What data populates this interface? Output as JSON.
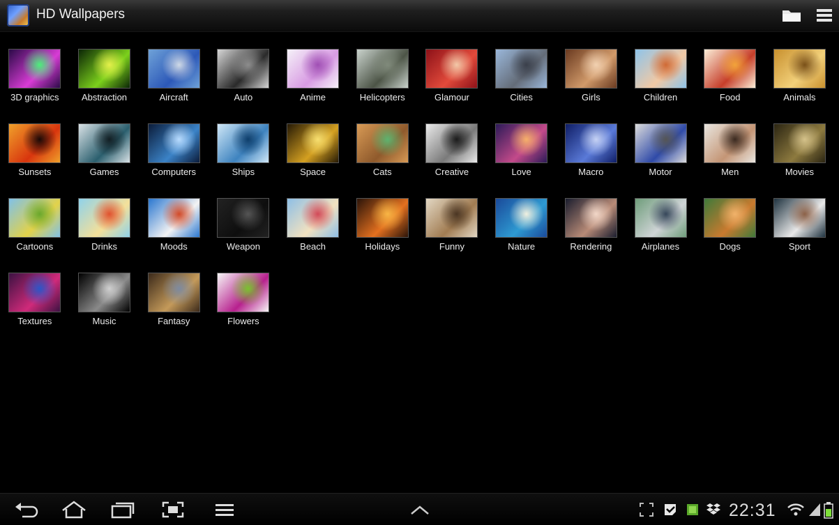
{
  "app": {
    "title": "HD Wallpapers"
  },
  "categories": [
    {
      "label": "3D graphics",
      "colors": [
        "#2b0a48",
        "#d83cd5",
        "#4bf07a"
      ]
    },
    {
      "label": "Abstraction",
      "colors": [
        "#0b2506",
        "#7cd11c",
        "#e4f04b"
      ]
    },
    {
      "label": "Aircraft",
      "colors": [
        "#6fa2d8",
        "#2c58b8",
        "#cfd9e6"
      ]
    },
    {
      "label": "Auto",
      "colors": [
        "#d6d6d6",
        "#2a2a2a",
        "#8d8d8d"
      ]
    },
    {
      "label": "Anime",
      "colors": [
        "#f5f1f8",
        "#d89be3",
        "#a04fb4"
      ]
    },
    {
      "label": "Helicopters",
      "colors": [
        "#c9d2cc",
        "#4c5446",
        "#808a7b"
      ]
    },
    {
      "label": "Glamour",
      "colors": [
        "#8d1118",
        "#e24a3b",
        "#f2c8a8"
      ]
    },
    {
      "label": "Cities",
      "colors": [
        "#9ab7da",
        "#646c78",
        "#3a3f4a"
      ]
    },
    {
      "label": "Girls",
      "colors": [
        "#6a3a20",
        "#d19a6a",
        "#f2d1b1"
      ]
    },
    {
      "label": "Children",
      "colors": [
        "#8ec4ea",
        "#f1c9a5",
        "#d06a35"
      ]
    },
    {
      "label": "Food",
      "colors": [
        "#fbeed8",
        "#c63e2a",
        "#f2a33a"
      ]
    },
    {
      "label": "Animals",
      "colors": [
        "#c8902e",
        "#f2d07a",
        "#7a5018"
      ]
    },
    {
      "label": "Sunsets",
      "colors": [
        "#f0a02a",
        "#d8350e",
        "#1a0906"
      ]
    },
    {
      "label": "Games",
      "colors": [
        "#d9e2e6",
        "#2b5f6e",
        "#121e23"
      ]
    },
    {
      "label": "Computers",
      "colors": [
        "#0b1c3a",
        "#3b83c7",
        "#b9dcff"
      ]
    },
    {
      "label": "Ships",
      "colors": [
        "#cfe7f7",
        "#3e83bf",
        "#0e3e6b"
      ]
    },
    {
      "label": "Space",
      "colors": [
        "#261a05",
        "#d4a021",
        "#f7df70"
      ]
    },
    {
      "label": "Cats",
      "colors": [
        "#d89a55",
        "#8f5a2c",
        "#5db36f"
      ]
    },
    {
      "label": "Creative",
      "colors": [
        "#eaeaea",
        "#7a7a7a",
        "#1b1b1b"
      ]
    },
    {
      "label": "Love",
      "colors": [
        "#2c1a58",
        "#c34a8a",
        "#f6b06a"
      ]
    },
    {
      "label": "Macro",
      "colors": [
        "#0f1e66",
        "#5a7ad8",
        "#c6d2f4"
      ]
    },
    {
      "label": "Motor",
      "colors": [
        "#dcdcdc",
        "#2f4aa8",
        "#555"
      ]
    },
    {
      "label": "Men",
      "colors": [
        "#e9e6e0",
        "#c49575",
        "#3b2a20"
      ]
    },
    {
      "label": "Movies",
      "colors": [
        "#2b2512",
        "#8d7a3f",
        "#d5c28a"
      ]
    },
    {
      "label": "Cartoons",
      "colors": [
        "#80c1e8",
        "#e2d24a",
        "#6aa82c"
      ]
    },
    {
      "label": "Drinks",
      "colors": [
        "#8fd2ea",
        "#f4e09a",
        "#e0522e"
      ]
    },
    {
      "label": "Moods",
      "colors": [
        "#2a77d0",
        "#f3f3f3",
        "#d24a28"
      ]
    },
    {
      "label": "Weapon",
      "colors": [
        "#222",
        "#0e0e0e",
        "#555"
      ]
    },
    {
      "label": "Beach",
      "colors": [
        "#8ebfe6",
        "#f2e2c0",
        "#d24a58"
      ]
    },
    {
      "label": "Holidays",
      "colors": [
        "#2b1409",
        "#e3701f",
        "#f8b545"
      ]
    },
    {
      "label": "Funny",
      "colors": [
        "#e2d7c3",
        "#a17c52",
        "#4b3623"
      ]
    },
    {
      "label": "Nature",
      "colors": [
        "#1a4a9a",
        "#2e9ad2",
        "#f0f0e0"
      ]
    },
    {
      "label": "Rendering",
      "colors": [
        "#1a1d2e",
        "#b88b77",
        "#f2d7c8"
      ]
    },
    {
      "label": "Airplanes",
      "colors": [
        "#6f9d7b",
        "#cfd4d6",
        "#36475a"
      ]
    },
    {
      "label": "Dogs",
      "colors": [
        "#3f7a3a",
        "#c97a2f",
        "#f1b26a"
      ]
    },
    {
      "label": "Sport",
      "colors": [
        "#1f3340",
        "#e8e8e8",
        "#8c6148"
      ]
    },
    {
      "label": "Textures",
      "colors": [
        "#3c1242",
        "#d02a7a",
        "#2a56c8"
      ]
    },
    {
      "label": "Music",
      "colors": [
        "#000",
        "#8a8a8a",
        "#d0d0d0"
      ]
    },
    {
      "label": "Fantasy",
      "colors": [
        "#3c2a1a",
        "#c49a5a",
        "#7d8aa0"
      ]
    },
    {
      "label": "Flowers",
      "colors": [
        "#f6f6f6",
        "#b7208e",
        "#79c32d"
      ]
    }
  ],
  "navbar": {
    "buttons": [
      "back-icon",
      "home-icon",
      "recent-apps-icon",
      "screenshot-icon",
      "menu-icon"
    ],
    "center": "chevron-up-icon"
  },
  "status": {
    "time": "22:31",
    "icons": [
      "expand-icon",
      "check-badge-icon",
      "android-icon",
      "dropbox-icon",
      "wifi-icon",
      "signal-icon",
      "battery-icon"
    ]
  }
}
